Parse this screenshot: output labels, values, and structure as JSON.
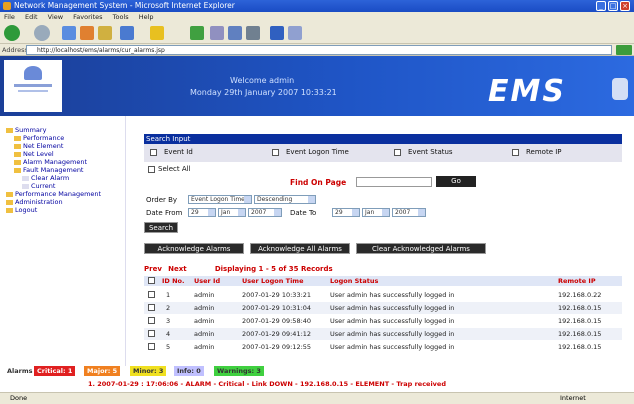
{
  "window": {
    "title": "Network Management System - Microsoft Internet Explorer"
  },
  "menu": [
    "File",
    "Edit",
    "View",
    "Favorites",
    "Tools",
    "Help"
  ],
  "address": {
    "label": "Address",
    "url": "http://localhost/ems/alarms/cur_alarms.jsp"
  },
  "header": {
    "welcome": "Welcome admin",
    "datetime": "Monday 29th January 2007 10:33:21",
    "logo": "EMS"
  },
  "sidebar": {
    "items": [
      "Summary",
      "Performance",
      "Net Element",
      "Net Level",
      "Alarm Management",
      "Fault Management",
      "Clear Alarm",
      "Current",
      "Performance Management",
      "Administration",
      "Logout"
    ]
  },
  "search": {
    "section_title": "Search Input",
    "checks": [
      "Event Id",
      "Event Logon Time",
      "Event Status",
      "Remote IP"
    ],
    "select_all": "Select All",
    "find_page_label": "Find On Page",
    "go_label": "Go",
    "order_by_label": "Order By",
    "order_by_value": "Event Logon Time",
    "order_dir_value": "Descending",
    "date_label": "Date From",
    "date_from": [
      "29",
      "Jan",
      "2007"
    ],
    "date_to_label": "Date To",
    "date_to": [
      "29",
      "Jan",
      "2007"
    ],
    "search_btn": "Search"
  },
  "actions": {
    "btn1": "Acknowledge Alarms",
    "btn2": "Acknowledge All Alarms",
    "btn3": "Clear Acknowledged Alarms"
  },
  "table": {
    "prev_label": "Prev",
    "next_label": "Next",
    "summary": "Displaying 1 - 5 of 35 Records",
    "headers": [
      "",
      "ID No.",
      "User Id",
      "User Logon Time",
      "Logon Status",
      "Remote IP"
    ],
    "rows": [
      [
        "1",
        "admin",
        "2007-01-29 10:33:21",
        "User admin has successfully logged in",
        "192.168.0.22"
      ],
      [
        "2",
        "admin",
        "2007-01-29 10:31:04",
        "User admin has successfully logged in",
        "192.168.0.15"
      ],
      [
        "3",
        "admin",
        "2007-01-29 09:58:40",
        "User admin has successfully logged in",
        "192.168.0.15"
      ],
      [
        "4",
        "admin",
        "2007-01-29 09:41:12",
        "User admin has successfully logged in",
        "192.168.0.15"
      ],
      [
        "5",
        "admin",
        "2007-01-29 09:12:55",
        "User admin has successfully logged in",
        "192.168.0.15"
      ]
    ]
  },
  "legend": {
    "label": "Alarms",
    "items": [
      {
        "text": "Critical: 1",
        "color": "#e02020"
      },
      {
        "text": "Major: 5",
        "color": "#f08020"
      },
      {
        "text": "Minor: 3",
        "color": "#f0e020"
      },
      {
        "text": "Info: 0",
        "color": "#c0c0ff"
      },
      {
        "text": "Warnings: 3",
        "color": "#40d040"
      }
    ]
  },
  "ticker": "1. 2007-01-29 : 17:06:06 - ALARM - Critical - Link DOWN - 192.168.0.15 - ELEMENT - Trap received",
  "status": {
    "left": "Done",
    "right": "Internet"
  },
  "colors": {
    "header": "#1f55c6",
    "section": "#0a2f9e",
    "accent": "#c00000"
  }
}
